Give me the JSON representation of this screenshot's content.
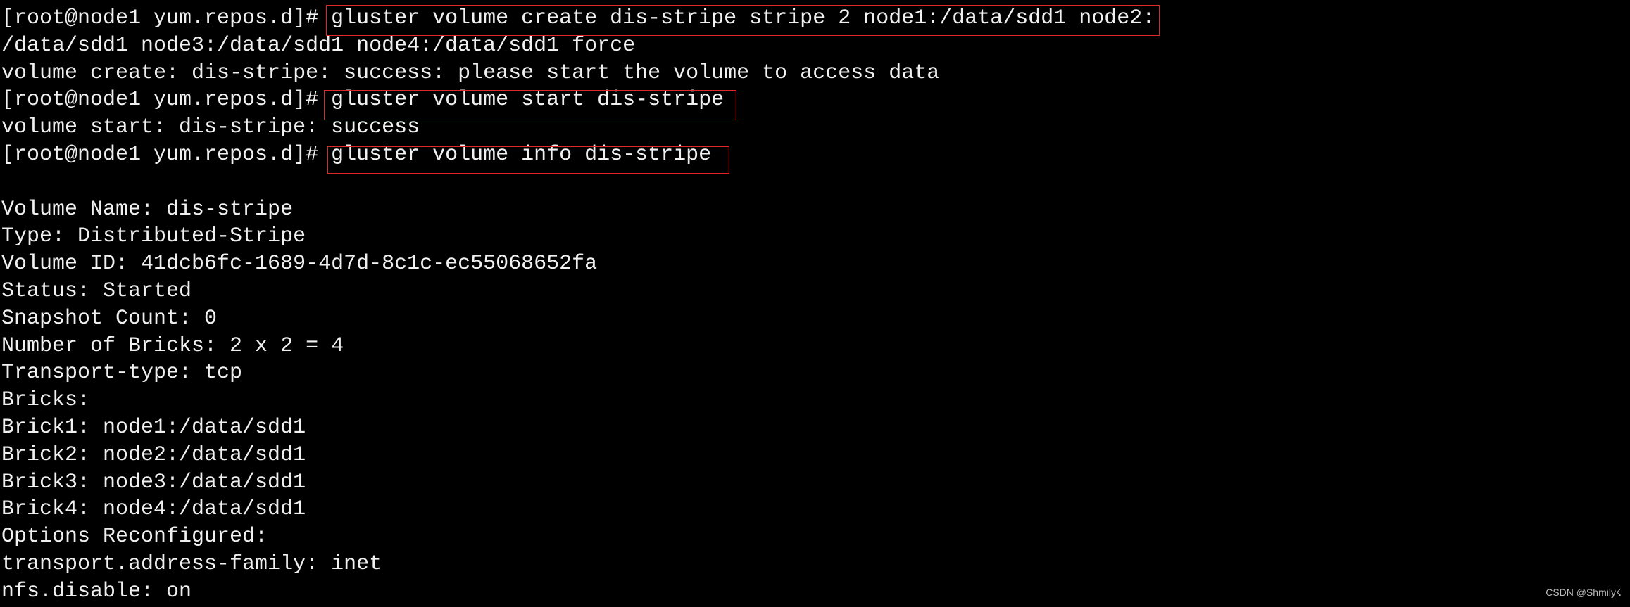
{
  "terminal": {
    "lines": [
      {
        "prompt": "[root@node1 yum.repos.d]# ",
        "command": "gluster volume create dis-stripe stripe 2 node1:/data/sdd1 node2:"
      },
      {
        "text": "/data/sdd1 node3:/data/sdd1 node4:/data/sdd1 force"
      },
      {
        "text": "volume create: dis-stripe: success: please start the volume to access data"
      },
      {
        "prompt": "[root@node1 yum.repos.d]# ",
        "command": "gluster volume start dis-stripe"
      },
      {
        "text": "volume start: dis-stripe: success"
      },
      {
        "prompt": "[root@node1 yum.repos.d]# ",
        "command": "gluster volume info dis-stripe"
      },
      {
        "text": ""
      },
      {
        "text": "Volume Name: dis-stripe"
      },
      {
        "text": "Type: Distributed-Stripe"
      },
      {
        "text": "Volume ID: 41dcb6fc-1689-4d7d-8c1c-ec55068652fa"
      },
      {
        "text": "Status: Started"
      },
      {
        "text": "Snapshot Count: 0"
      },
      {
        "text": "Number of Bricks: 2 x 2 = 4"
      },
      {
        "text": "Transport-type: tcp"
      },
      {
        "text": "Bricks:"
      },
      {
        "text": "Brick1: node1:/data/sdd1"
      },
      {
        "text": "Brick2: node2:/data/sdd1"
      },
      {
        "text": "Brick3: node3:/data/sdd1"
      },
      {
        "text": "Brick4: node4:/data/sdd1"
      },
      {
        "text": "Options Reconfigured:"
      },
      {
        "text": "transport.address-family: inet"
      },
      {
        "text": "nfs.disable: on"
      }
    ],
    "text_color": "#f0f0f0",
    "highlight_color": "#e02828"
  },
  "watermark": "CSDN @Shmily☇"
}
